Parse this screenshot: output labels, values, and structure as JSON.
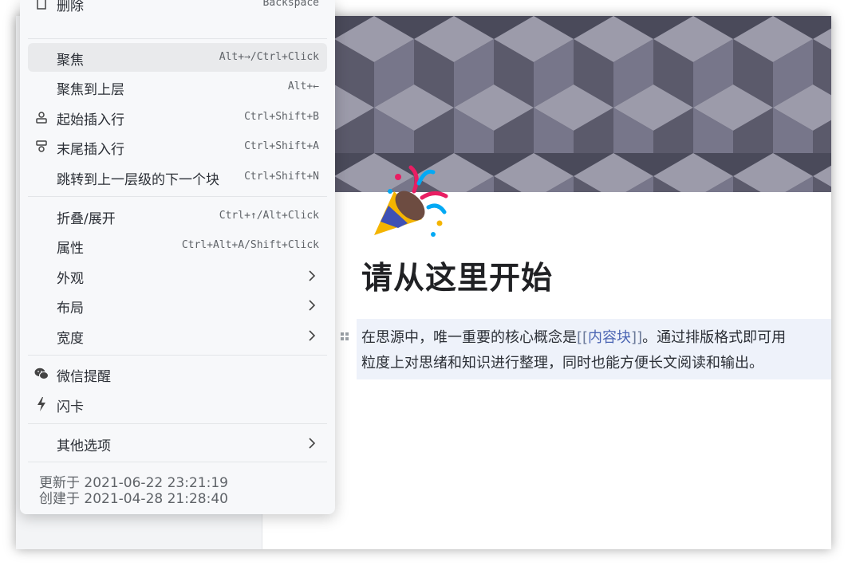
{
  "menu": {
    "items": [
      {
        "label": "删除",
        "shortcut": "Backspace",
        "icon": "trash-icon"
      },
      {
        "label": "聚焦",
        "shortcut": "Alt+→/Ctrl+Click"
      },
      {
        "label": "聚焦到上层",
        "shortcut": "Alt+←"
      },
      {
        "label": "起始插入行",
        "shortcut": "Ctrl+Shift+B",
        "icon": "insert-before-icon"
      },
      {
        "label": "末尾插入行",
        "shortcut": "Ctrl+Shift+A",
        "icon": "insert-after-icon"
      },
      {
        "label": "跳转到上一层级的下一个块",
        "shortcut": "Ctrl+Shift+N"
      },
      {
        "label": "折叠/展开",
        "shortcut": "Ctrl+↑/Alt+Click"
      },
      {
        "label": "属性",
        "shortcut": "Ctrl+Alt+A/Shift+Click"
      },
      {
        "label": "外观",
        "submenu": true
      },
      {
        "label": "布局",
        "submenu": true
      },
      {
        "label": "宽度",
        "submenu": true
      },
      {
        "label": "微信提醒",
        "icon": "wechat-icon"
      },
      {
        "label": "闪卡",
        "icon": "lightning-icon"
      },
      {
        "label": "其他选项",
        "submenu": true
      }
    ],
    "updated": "更新于 2021-06-22 23:21:19",
    "created": "创建于 2021-04-28 21:28:40"
  },
  "doc": {
    "title": "请从这里开始",
    "paragraph_line1_before": "在思源中，唯一重要的核心概念是",
    "ref_open": "[[",
    "ref_text": "内容块",
    "ref_close": "]]",
    "paragraph_line1_after": "。通过排版格式即可用",
    "paragraph_line2": "粒度上对思绪和知识进行整理，同时也能方便长文阅读和输出。"
  },
  "colors": {
    "menu_bg": "#f7f8fa",
    "active_item_bg": "#e9eaec",
    "ref_link": "#4b65b3",
    "paragraph_highlight": "#eef2fa"
  }
}
